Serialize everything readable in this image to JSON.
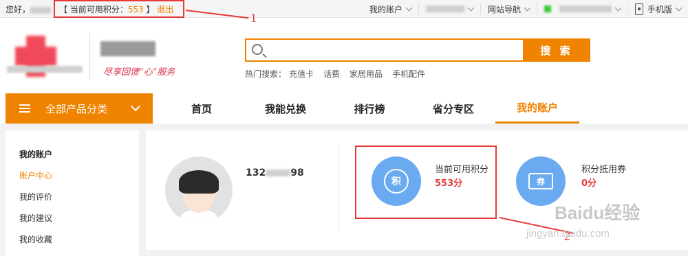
{
  "topbar": {
    "greeting": "您好，",
    "points_open": "【 当前可用积分：",
    "points_value": "553",
    "points_close": " 】",
    "logout": "退出",
    "my_account": "我的账户",
    "site_nav": "网站导航",
    "mobile": "手机版"
  },
  "annotations": {
    "one": "1",
    "two": "2"
  },
  "header": {
    "slogan": "尽享回馈“心”服务",
    "search_button": "搜 索",
    "hot_label": "热门搜索：",
    "hot_items": [
      "充值卡",
      "话费",
      "家居用品",
      "手机配件"
    ]
  },
  "nav": {
    "category": "全部产品分类",
    "items": [
      "首页",
      "我能兑换",
      "排行榜",
      "省分专区",
      "我的账户"
    ]
  },
  "sidebar": {
    "title": "我的账户",
    "items": [
      "账户中心",
      "我的评价",
      "我的建议",
      "我的收藏"
    ]
  },
  "account": {
    "phone_prefix": "132",
    "phone_suffix": "98",
    "points_label": "当前可用积分",
    "points_value": "553分",
    "points_icon": "积",
    "coupon_label": "积分抵用券",
    "coupon_value": "0分",
    "coupon_icon": "券"
  },
  "watermark": {
    "brand": "Baidu经验",
    "url": "jingyan.baidu.com"
  }
}
